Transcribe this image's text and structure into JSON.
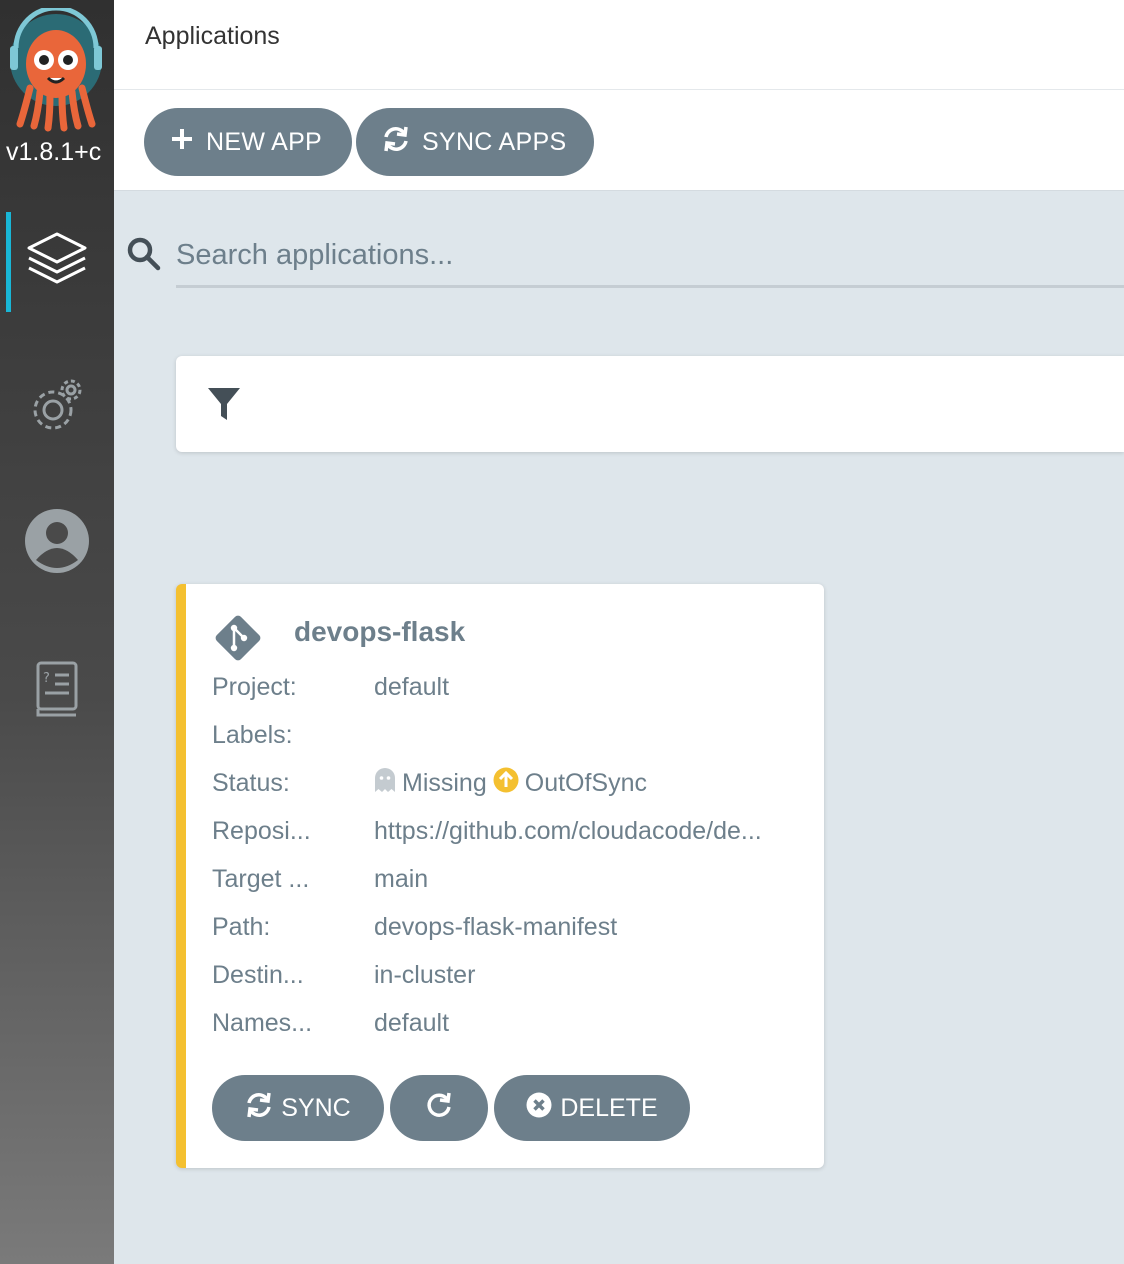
{
  "app": {
    "version": "v1.8.1+c"
  },
  "nav": {
    "items": [
      "applications-icon",
      "settings-icon",
      "user-icon",
      "docs-icon"
    ]
  },
  "header": {
    "title": "Applications"
  },
  "toolbar": {
    "new_app_label": "NEW APP",
    "sync_apps_label": "SYNC APPS"
  },
  "search": {
    "placeholder": "Search applications..."
  },
  "card": {
    "name": "devops-flask",
    "accent_color": "#f4c030",
    "rows": [
      {
        "label": "Project:",
        "value": "default"
      },
      {
        "label": "Labels:",
        "value": ""
      },
      {
        "label": "Status:",
        "health": "Missing",
        "sync": "OutOfSync"
      },
      {
        "label": "Reposi...",
        "value": "https://github.com/cloudacode/de..."
      },
      {
        "label": "Target ...",
        "value": "main"
      },
      {
        "label": "Path:",
        "value": "devops-flask-manifest"
      },
      {
        "label": "Destin...",
        "value": "in-cluster"
      },
      {
        "label": "Names...",
        "value": "default"
      }
    ],
    "buttons": {
      "sync_label": "SYNC",
      "delete_label": "DELETE"
    }
  },
  "colors": {
    "primary": "#6d7f8b",
    "active_nav": "#19b6d6",
    "out_of_sync": "#f4c030"
  }
}
